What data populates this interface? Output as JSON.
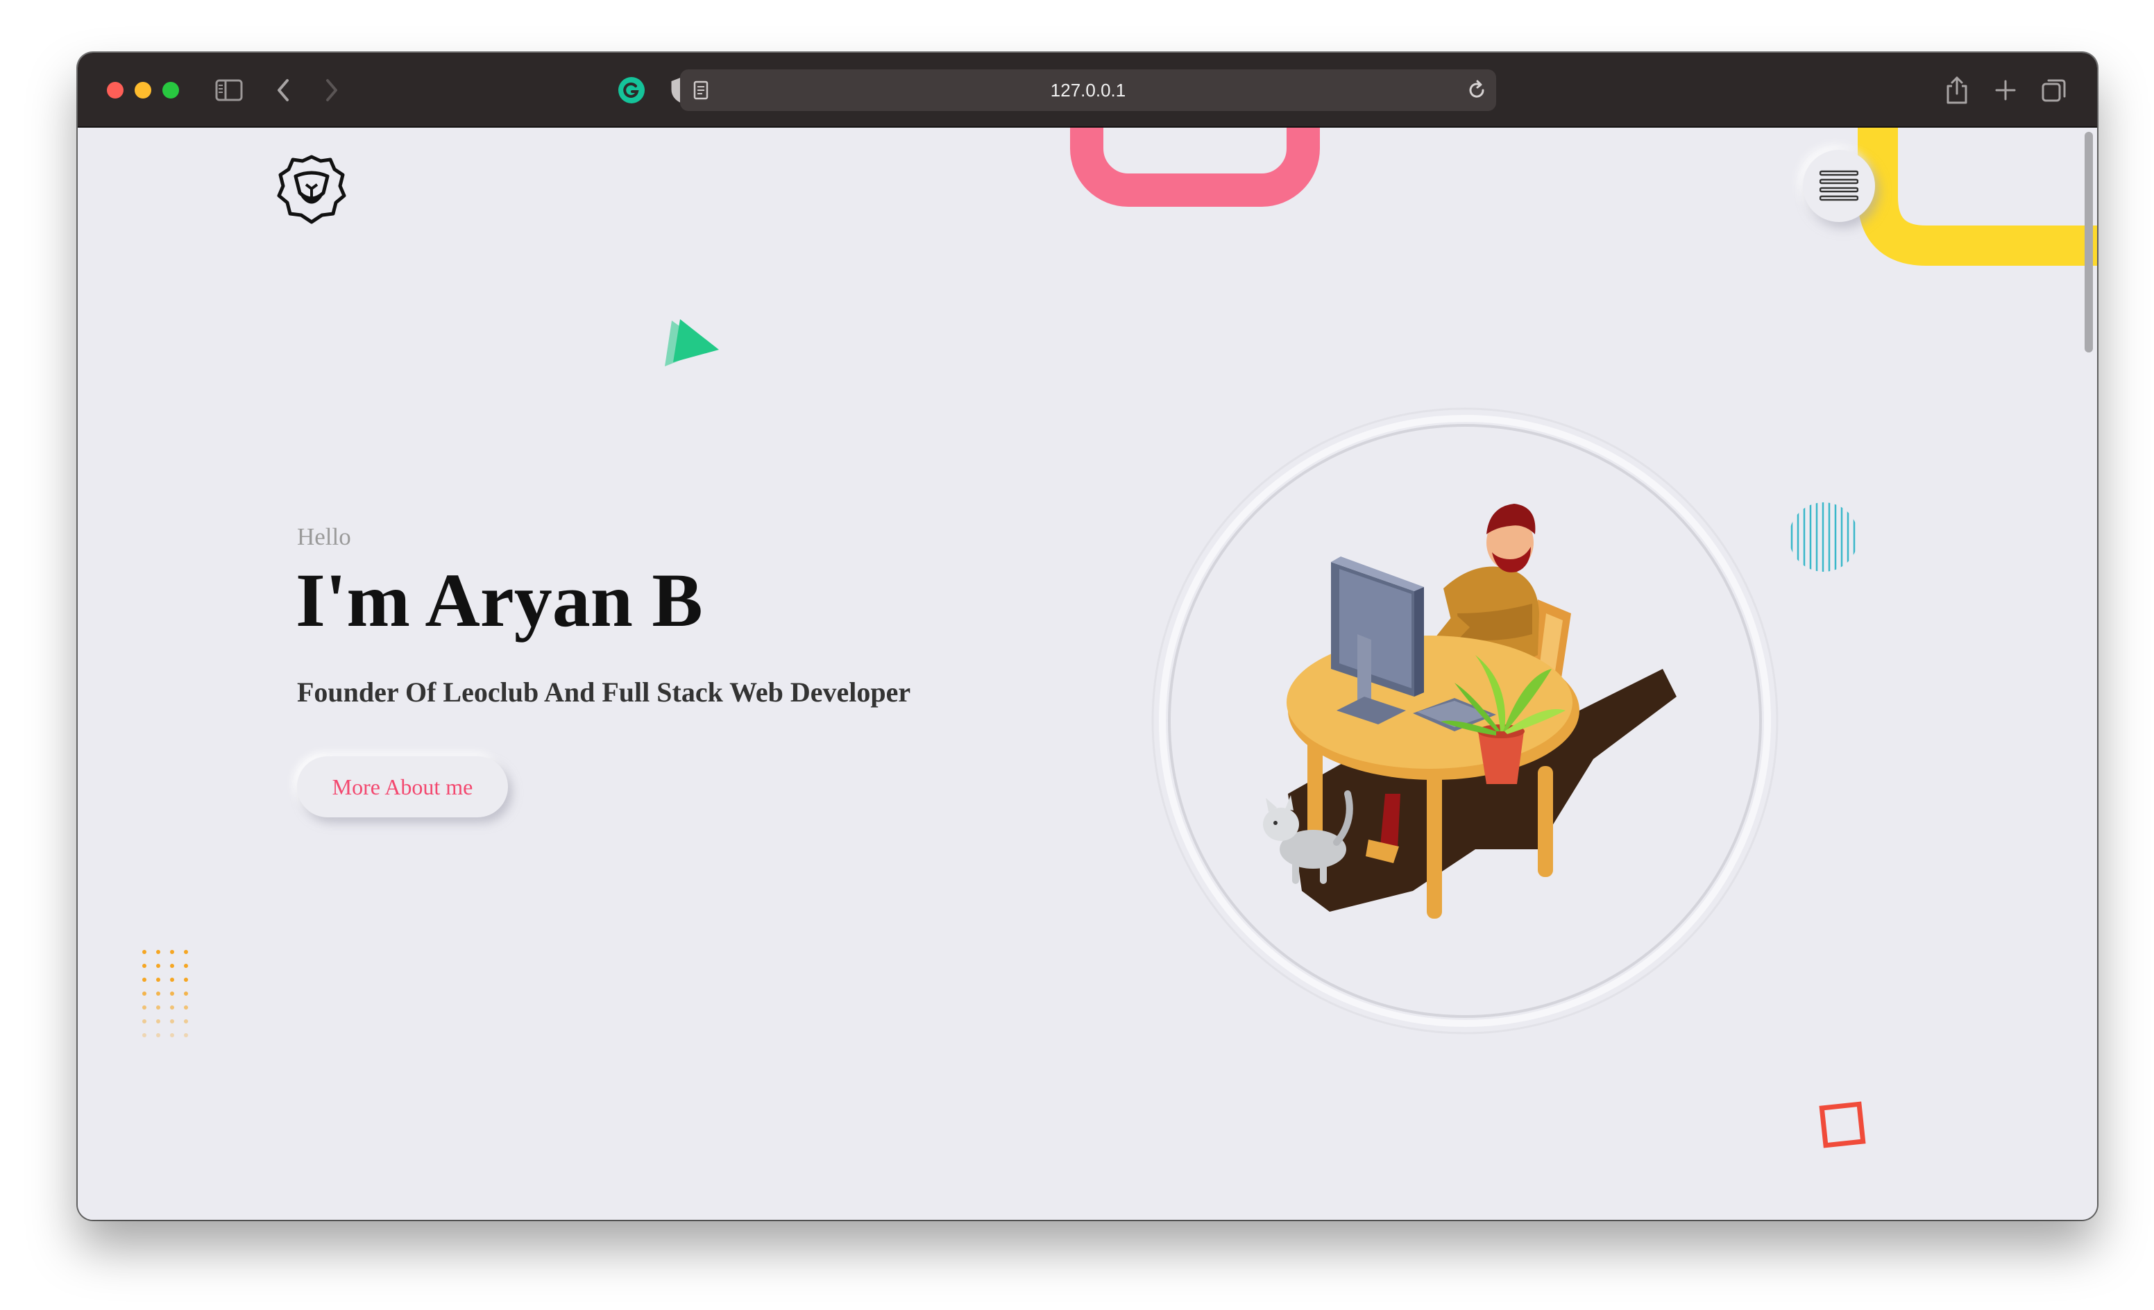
{
  "browser": {
    "url": "127.0.0.1",
    "colors": {
      "titlebar": "#2d2828",
      "urlbar": "#423c3c"
    },
    "icons": [
      "sidebar-toggle-icon",
      "back-icon",
      "forward-icon",
      "grammarly-icon",
      "privacy-shield-icon",
      "page-icon",
      "reload-icon",
      "share-icon",
      "new-tab-icon",
      "tab-overview-icon"
    ]
  },
  "page": {
    "greeting": "Hello",
    "name": "I'm Aryan B",
    "subtitle": "Founder Of Leoclub And Full Stack Web Developer",
    "cta_label": "More About me",
    "colors": {
      "background": "#ebebf1",
      "accent": "#f3486f",
      "pink_shape": "#f76e8d",
      "yellow_shape": "#fdd92c",
      "green_shape": "#22c987",
      "orange_dots": "#f5a623",
      "red_square": "#f04b3a"
    },
    "icons": [
      "lion-logo-icon",
      "hamburger-menu-icon"
    ]
  }
}
